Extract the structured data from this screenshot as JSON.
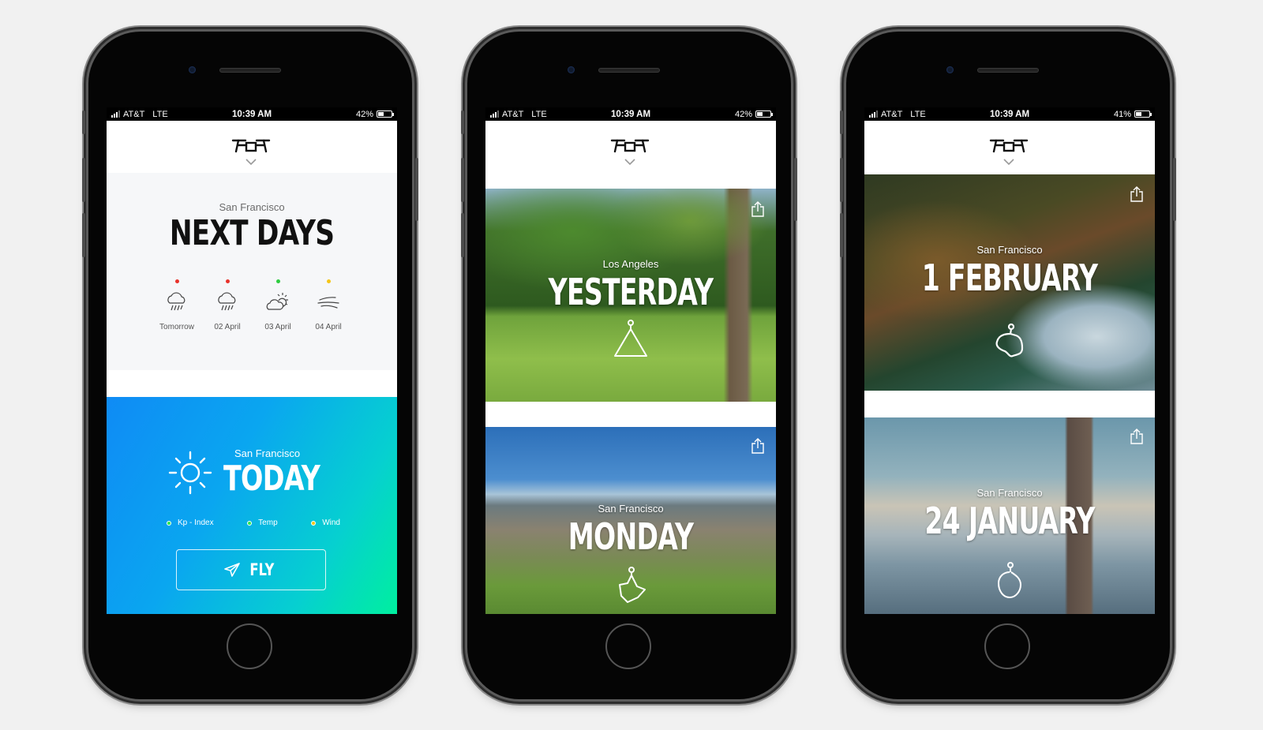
{
  "status_bar": [
    {
      "carrier": "AT&T",
      "network": "LTE",
      "time": "10:39 AM",
      "battery": "42%",
      "battery_level": 0.42
    },
    {
      "carrier": "AT&T",
      "network": "LTE",
      "time": "10:39 AM",
      "battery": "42%",
      "battery_level": 0.42
    },
    {
      "carrier": "AT&T",
      "network": "LTE",
      "time": "10:39 AM",
      "battery": "41%",
      "battery_level": 0.41
    }
  ],
  "app": {
    "logo_icon": "drone-logo-icon",
    "menu_icon": "chevron-down-icon"
  },
  "screen1": {
    "next_days": {
      "city": "San Francisco",
      "title": "NEXT DAYS",
      "forecast": [
        {
          "label": "Tomorrow",
          "icon": "rain-cloud-icon",
          "status_color": "#e8322b"
        },
        {
          "label": "02 April",
          "icon": "rain-cloud-icon",
          "status_color": "#e8322b"
        },
        {
          "label": "03 April",
          "icon": "partly-cloudy-icon",
          "status_color": "#2ecc40"
        },
        {
          "label": "04 April",
          "icon": "wind-icon",
          "status_color": "#f5c518"
        }
      ]
    },
    "today": {
      "city": "San Francisco",
      "title": "TODAY",
      "icon": "sun-icon",
      "indicators": [
        {
          "label": "Kp - Index",
          "color": "#2ee84a"
        },
        {
          "label": "Temp",
          "color": "#2ee84a"
        },
        {
          "label": "Wind",
          "color": "#f5c518"
        }
      ],
      "fly_button": "FLY",
      "fly_icon": "paper-plane-icon"
    }
  },
  "screen2": {
    "cards": [
      {
        "city": "Los Angeles",
        "title": "YESTERDAY",
        "route_icon": "triangle-route-icon",
        "share_icon": "share-icon"
      },
      {
        "city": "San Francisco",
        "title": "MONDAY",
        "route_icon": "star-route-icon",
        "share_icon": "share-icon"
      }
    ]
  },
  "screen3": {
    "cards": [
      {
        "city": "San Francisco",
        "title": "1 FEBRUARY",
        "route_icon": "blob-route-icon",
        "share_icon": "share-icon"
      },
      {
        "city": "San Francisco",
        "title": "24 JANUARY",
        "route_icon": "loop-route-icon",
        "share_icon": "share-icon"
      }
    ]
  }
}
